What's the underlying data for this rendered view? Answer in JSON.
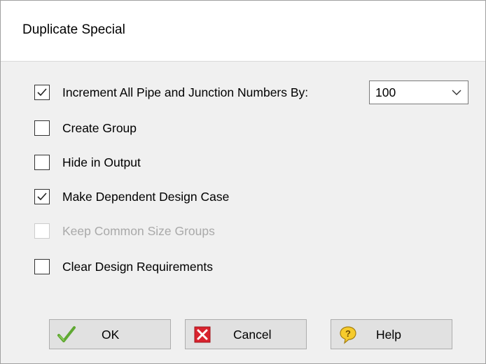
{
  "dialog": {
    "title": "Duplicate Special",
    "increment": {
      "label": "Increment All Pipe and Junction Numbers By:",
      "checked": true,
      "value": "100"
    },
    "options": [
      {
        "label": "Create Group",
        "checked": false,
        "enabled": true
      },
      {
        "label": "Hide in Output",
        "checked": false,
        "enabled": true
      },
      {
        "label": "Make Dependent Design Case",
        "checked": true,
        "enabled": true
      },
      {
        "label": "Keep Common Size Groups",
        "checked": false,
        "enabled": false
      },
      {
        "label": "Clear Design Requirements",
        "checked": false,
        "enabled": true
      }
    ],
    "buttons": {
      "ok": {
        "label": "OK",
        "icon": "green-checkmark-icon"
      },
      "cancel": {
        "label": "Cancel",
        "icon": "red-x-icon"
      },
      "help": {
        "label": "Help",
        "icon": "question-bubble-icon"
      }
    }
  }
}
